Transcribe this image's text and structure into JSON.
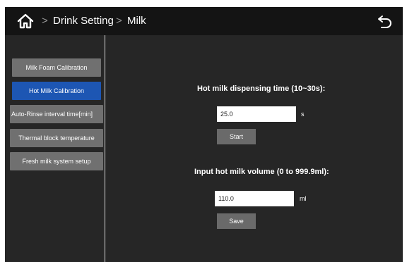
{
  "header": {
    "home_icon": "home-icon",
    "separator": ">",
    "crumb1": "Drink Setting",
    "crumb2": "Milk",
    "back_icon": "back-icon"
  },
  "sidebar": {
    "items": [
      {
        "label": "Milk Foam Calibration",
        "active": false
      },
      {
        "label": "Hot Milk Calibration",
        "active": true
      },
      {
        "label": "Auto-Rinse interval time[min]",
        "active": false
      },
      {
        "label": "Thermal block temperature",
        "active": false
      },
      {
        "label": "Fresh milk system setup",
        "active": false
      }
    ]
  },
  "main": {
    "dispense_label": "Hot milk dispensing time (10~30s):",
    "dispense_value": "25.0",
    "dispense_unit": "s",
    "start_label": "Start",
    "volume_label": "Input  hot milk volume (0 to 999.9ml):",
    "volume_value": "110.0",
    "volume_unit": "ml",
    "save_label": "Save"
  },
  "colors": {
    "accent": "#1d56b3",
    "button": "#707070",
    "background": "#262626",
    "header": "#141414"
  }
}
